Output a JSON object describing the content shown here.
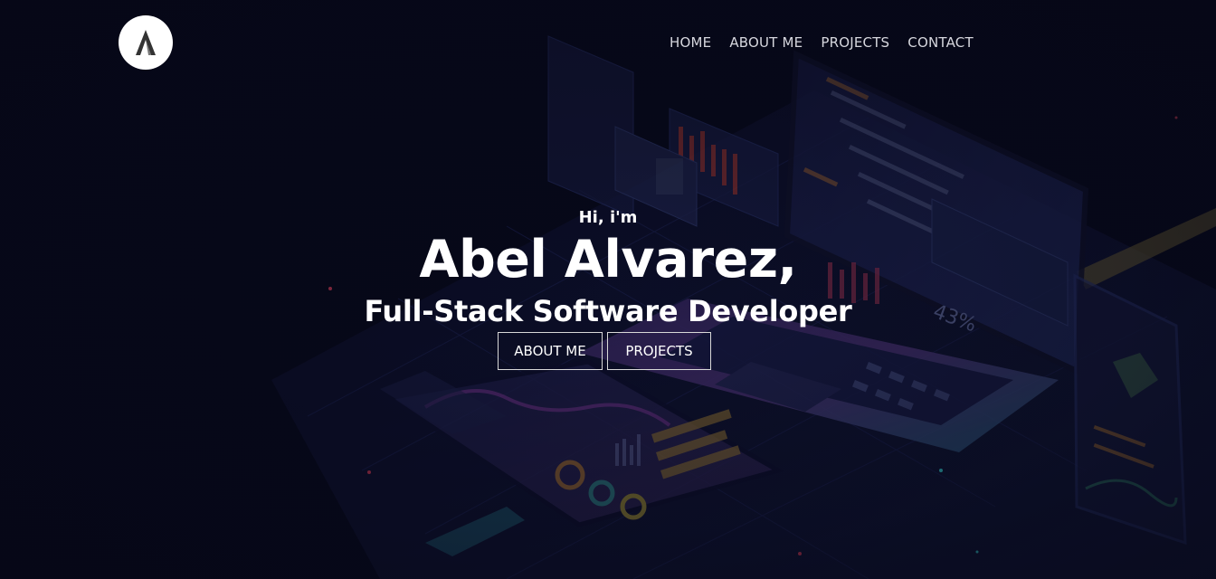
{
  "header": {
    "logo_icon": "letter-a-logo-icon",
    "nav": [
      {
        "label": "HOME"
      },
      {
        "label": "ABOUT ME"
      },
      {
        "label": "PROJECTS"
      },
      {
        "label": "CONTACT"
      }
    ]
  },
  "hero": {
    "greeting": "Hi, i'm",
    "name": "Abel Alvarez,",
    "role": "Full-Stack Software Developer",
    "buttons": {
      "about": "ABOUT ME",
      "projects": "PROJECTS"
    }
  },
  "background": {
    "illustration": "isometric-laptop-dashboard-illustration",
    "overlay_text": "43%"
  },
  "colors": {
    "background": "#07081a",
    "text": "#ffffff",
    "nav_text": "#d6d7de",
    "button_border": "#d8d8d8"
  }
}
